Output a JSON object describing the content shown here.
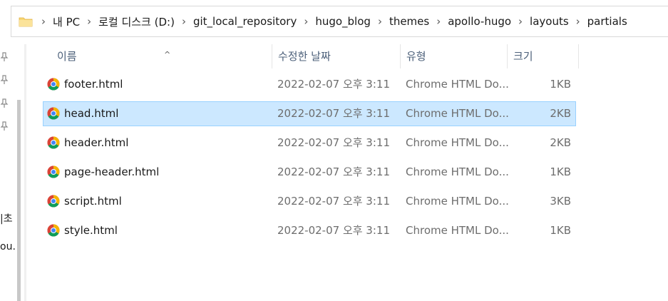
{
  "breadcrumb": {
    "items": [
      "내 PC",
      "로컬 디스크 (D:)",
      "git_local_repository",
      "hugo_blog",
      "themes",
      "apollo-hugo",
      "layouts",
      "partials"
    ],
    "separator": "›"
  },
  "left_pane": {
    "cut_text_1": "|초",
    "cut_text_2": "ou."
  },
  "columns": {
    "name": "이름",
    "date": "수정한 날짜",
    "type": "유형",
    "size": "크기"
  },
  "files": [
    {
      "name": "footer.html",
      "date": "2022-02-07 오후 3:11",
      "type": "Chrome HTML Do...",
      "size": "1KB",
      "selected": false
    },
    {
      "name": "head.html",
      "date": "2022-02-07 오후 3:11",
      "type": "Chrome HTML Do...",
      "size": "2KB",
      "selected": true
    },
    {
      "name": "header.html",
      "date": "2022-02-07 오후 3:11",
      "type": "Chrome HTML Do...",
      "size": "2KB",
      "selected": false
    },
    {
      "name": "page-header.html",
      "date": "2022-02-07 오후 3:11",
      "type": "Chrome HTML Do...",
      "size": "1KB",
      "selected": false
    },
    {
      "name": "script.html",
      "date": "2022-02-07 오후 3:11",
      "type": "Chrome HTML Do...",
      "size": "3KB",
      "selected": false
    },
    {
      "name": "style.html",
      "date": "2022-02-07 오후 3:11",
      "type": "Chrome HTML Do...",
      "size": "1KB",
      "selected": false
    }
  ],
  "colors": {
    "selection_bg": "#cce8ff",
    "selection_border": "#99d1ff",
    "header_text": "#4c607a",
    "folder_yellow": "#f8d775"
  },
  "icons": {
    "folder": "folder-icon",
    "file": "chrome-icon",
    "pin": "pin-icon"
  }
}
